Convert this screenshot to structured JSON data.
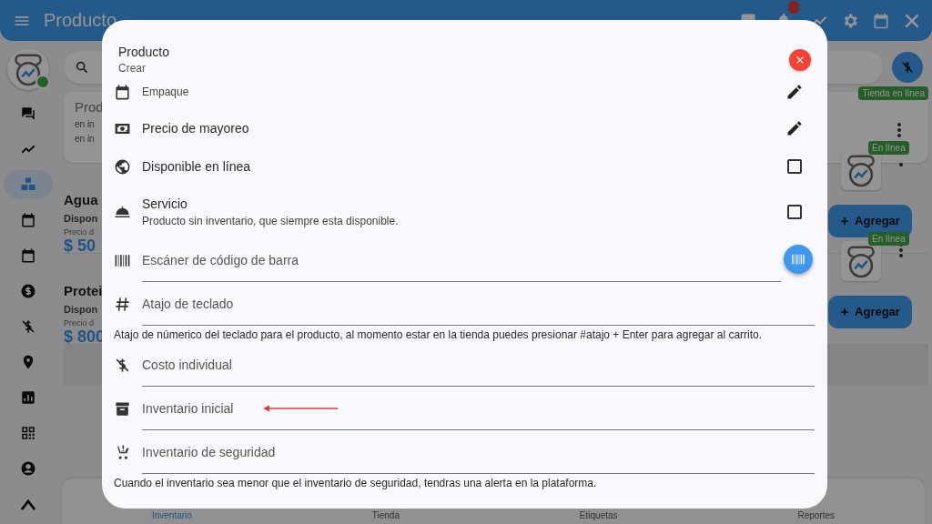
{
  "app_bar": {
    "title": "Producto"
  },
  "sidebar": {
    "items": [
      {
        "selected": false
      },
      {
        "selected": false
      },
      {
        "selected": true
      },
      {
        "selected": false
      },
      {
        "selected": false
      },
      {
        "selected": false
      },
      {
        "selected": false
      },
      {
        "selected": false
      },
      {
        "selected": false
      },
      {
        "selected": false
      },
      {
        "selected": false
      },
      {
        "selected": false
      }
    ]
  },
  "store_card": {
    "title": "Prod",
    "lines": [
      "en in",
      "en in"
    ],
    "badge": "Tienda en línea"
  },
  "products": [
    {
      "name": "Agua",
      "availability": "Dispon",
      "price_label": "Precio d",
      "price": "$ 50",
      "badge": "En línea",
      "button": "Agregar"
    },
    {
      "name": "Protei",
      "availability": "Dispon",
      "price_label": "Precio d",
      "price": "$ 800",
      "badge": "En línea",
      "button": "Agregar"
    }
  ],
  "bottom_nav": [
    {
      "label": "Inventario",
      "selected": true
    },
    {
      "label": "Tienda",
      "selected": false
    },
    {
      "label": "Etiquetas",
      "selected": false
    },
    {
      "label": "Reportes",
      "selected": false
    }
  ],
  "dialog": {
    "title": "Producto",
    "subtitle": "Crear",
    "rows": [
      {
        "kind": "edit",
        "subtitle": "Empaque"
      },
      {
        "kind": "edit",
        "label": "Precio de mayoreo"
      },
      {
        "kind": "check",
        "label": "Disponible en línea",
        "checked": false
      },
      {
        "kind": "check",
        "label": "Servicio",
        "subtitle": "Producto sin inventario, que siempre esta disponible.",
        "checked": false
      },
      {
        "kind": "field",
        "placeholder": "Escáner de código de barra",
        "scan": true
      },
      {
        "kind": "field",
        "placeholder": "Atajo de teclado",
        "helper": "Atajo de númerico del teclado para el producto, al momento estar en la tienda puedes presionar #atajo + Enter para agregar al carrito."
      },
      {
        "kind": "field",
        "placeholder": "Costo individual"
      },
      {
        "kind": "field",
        "placeholder": "Inventario inicial",
        "marked": true
      },
      {
        "kind": "field",
        "placeholder": "Inventario de seguridad",
        "helper": "Cuando el inventario sea menor que el inventario de seguridad, tendras una alerta en la plataforma."
      }
    ]
  }
}
